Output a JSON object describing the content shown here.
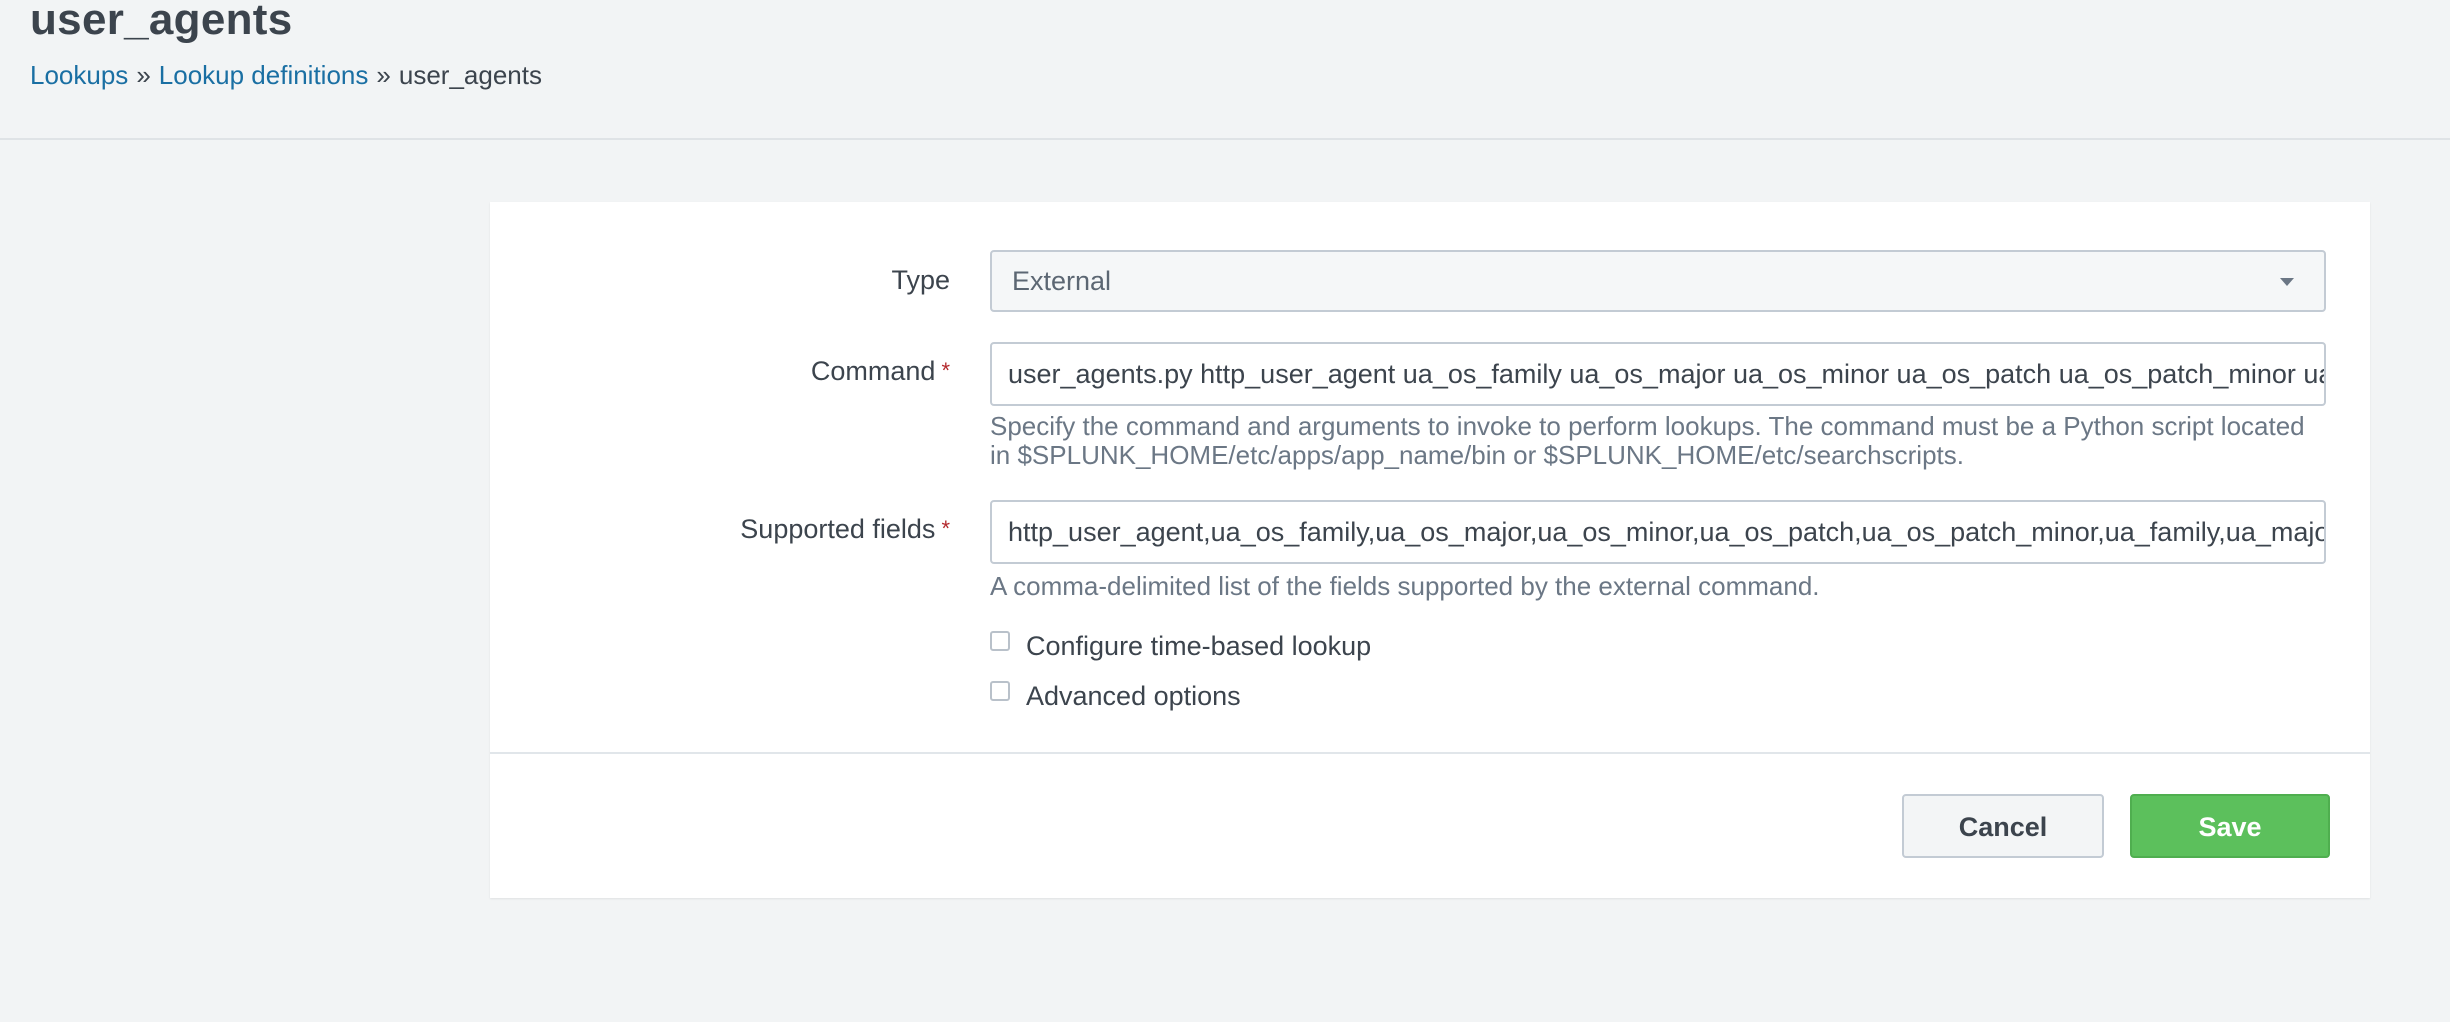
{
  "page": {
    "title": "user_agents"
  },
  "breadcrumb": {
    "lookups": "Lookups",
    "separator": "»",
    "lookup_definitions": "Lookup definitions",
    "current": "user_agents"
  },
  "form": {
    "type": {
      "label": "Type",
      "selected": "External"
    },
    "command": {
      "label": "Command",
      "required": "*",
      "value": "user_agents.py http_user_agent ua_os_family ua_os_major ua_os_minor ua_os_patch ua_os_patch_minor ua_family ua_major ua_minor ua_patch",
      "help": "Specify the command and arguments to invoke to perform lookups. The command must be a Python script located in $SPLUNK_HOME/etc/apps/app_name/bin or $SPLUNK_HOME/etc/searchscripts."
    },
    "supported_fields": {
      "label": "Supported fields",
      "required": "*",
      "value": "http_user_agent,ua_os_family,ua_os_major,ua_os_minor,ua_os_patch,ua_os_patch_minor,ua_family,ua_major,ua_minor,ua_patch",
      "help": "A comma-delimited list of the fields supported by the external command."
    },
    "time_based_lookup": {
      "label": "Configure time-based lookup",
      "checked": false
    },
    "advanced_options": {
      "label": "Advanced options",
      "checked": false
    }
  },
  "buttons": {
    "cancel": "Cancel",
    "save": "Save"
  },
  "colors": {
    "link": "#1a6fa3",
    "required": "#b3272b",
    "save_button": "#5cc05c",
    "page_background": "#f2f4f5"
  }
}
